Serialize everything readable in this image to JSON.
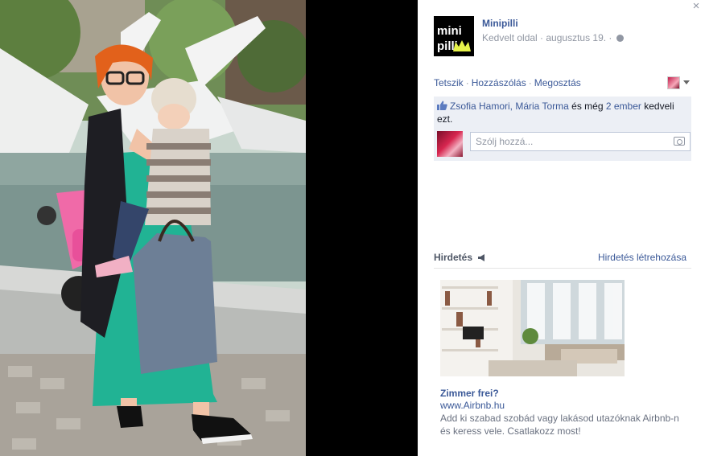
{
  "colors": {
    "link": "#3b5998",
    "muted": "#9197a3",
    "ufi_bg": "#eceff5",
    "stage_bg": "#000000"
  },
  "photo": {
    "icon": "photo-of-mother-and-child"
  },
  "page": {
    "name": "Minipilli",
    "logo_text_top": "mini",
    "logo_text_bottom": "pilli",
    "meta": "Kedvelt oldal · augusztus 19. ·",
    "privacy_icon": "globe-icon"
  },
  "actions": {
    "like": "Tetszik",
    "comment": "Hozzászólás",
    "share": "Megosztás",
    "sep": "·"
  },
  "likes": {
    "names": "Zsofia Hamori, Mária Torma",
    "and_more": "és még",
    "others_link": "2 ember",
    "suffix": "kedveli ezt."
  },
  "comment": {
    "placeholder": "Szólj hozzá..."
  },
  "ads": {
    "heading": "Hirdetés",
    "create_link": "Hirdetés létrehozása",
    "title": "Zimmer frei?",
    "url": "www.Airbnb.hu",
    "description": "Add ki szabad szobád vagy lakásod utazóknak Airbnb-n és keress vele. Csatlakozz most!"
  },
  "close_label": "×"
}
